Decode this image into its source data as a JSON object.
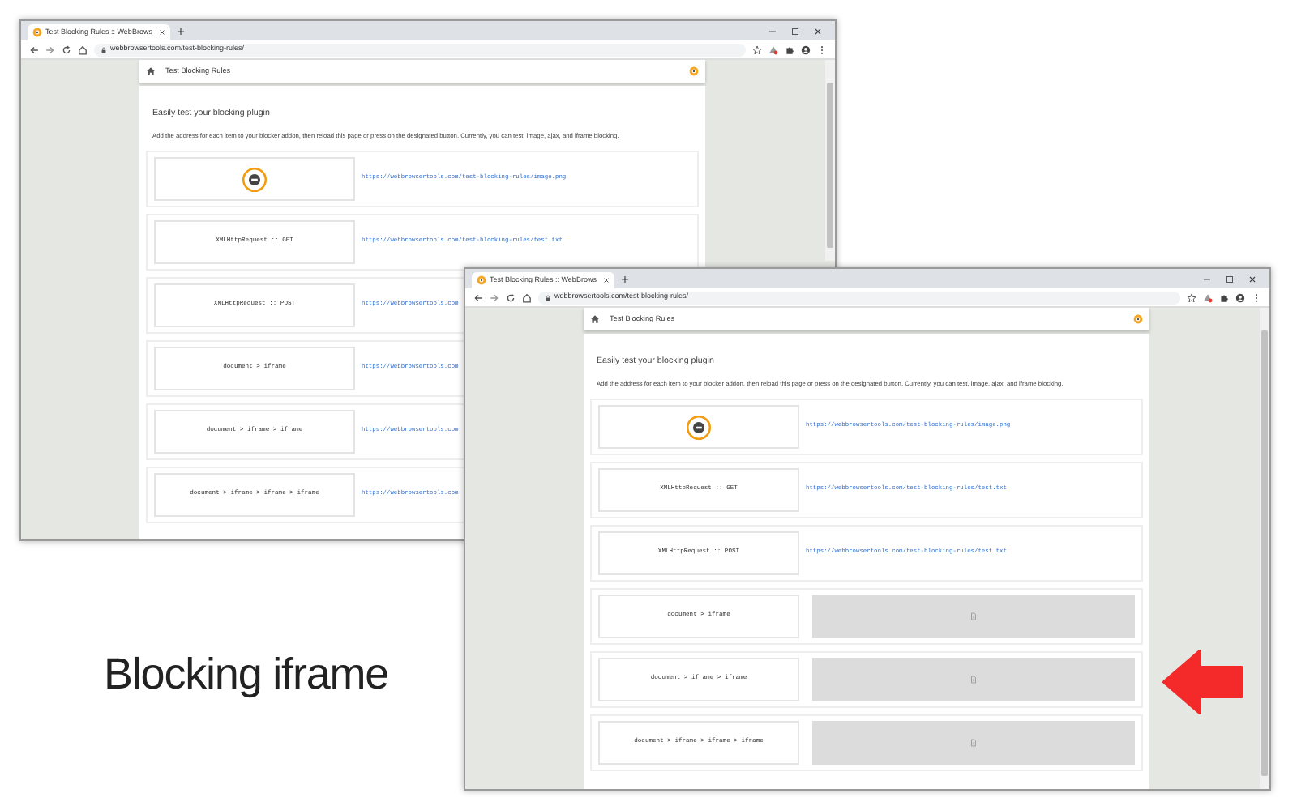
{
  "windows": [
    {
      "tab_title": "Test Blocking Rules :: WebBrows",
      "url": "webbrowsertools.com/test-blocking-rules/",
      "page_title": "Test Blocking Rules",
      "heading": "Easily test your blocking plugin",
      "description": "Add the address for each item to your blocker addon, then reload this page or press on the designated button. Currently, you can test, image, ajax, and iframe blocking.",
      "rows": [
        {
          "kind": "image",
          "link": "https://webbrowsertools.com/test-blocking-rules/image.png"
        },
        {
          "kind": "request",
          "label": "XMLHttpRequest :: GET",
          "link": "https://webbrowsertools.com/test-blocking-rules/test.txt"
        },
        {
          "kind": "request",
          "label": "XMLHttpRequest :: POST",
          "link": "https://webbrowsertools.com"
        },
        {
          "kind": "request",
          "label": "document > iframe",
          "link": "https://webbrowsertools.com"
        },
        {
          "kind": "request",
          "label": "document > iframe > iframe",
          "link": "https://webbrowsertools.com"
        },
        {
          "kind": "request",
          "label": "document > iframe > iframe > iframe",
          "link": "https://webbrowsertools.com"
        }
      ]
    },
    {
      "tab_title": "Test Blocking Rules :: WebBrows",
      "url": "webbrowsertools.com/test-blocking-rules/",
      "page_title": "Test Blocking Rules",
      "heading": "Easily test your blocking plugin",
      "description": "Add the address for each item to your blocker addon, then reload this page or press on the designated button. Currently, you can test, image, ajax, and iframe blocking.",
      "rows": [
        {
          "kind": "image",
          "link": "https://webbrowsertools.com/test-blocking-rules/image.png"
        },
        {
          "kind": "request",
          "label": "XMLHttpRequest :: GET",
          "link": "https://webbrowsertools.com/test-blocking-rules/test.txt"
        },
        {
          "kind": "request",
          "label": "XMLHttpRequest :: POST",
          "link": "https://webbrowsertools.com/test-blocking-rules/test.txt"
        },
        {
          "kind": "blocked",
          "label": "document > iframe"
        },
        {
          "kind": "blocked",
          "label": "document > iframe > iframe"
        },
        {
          "kind": "blocked",
          "label": "document > iframe > iframe > iframe"
        }
      ]
    }
  ],
  "caption": "Blocking iframe"
}
